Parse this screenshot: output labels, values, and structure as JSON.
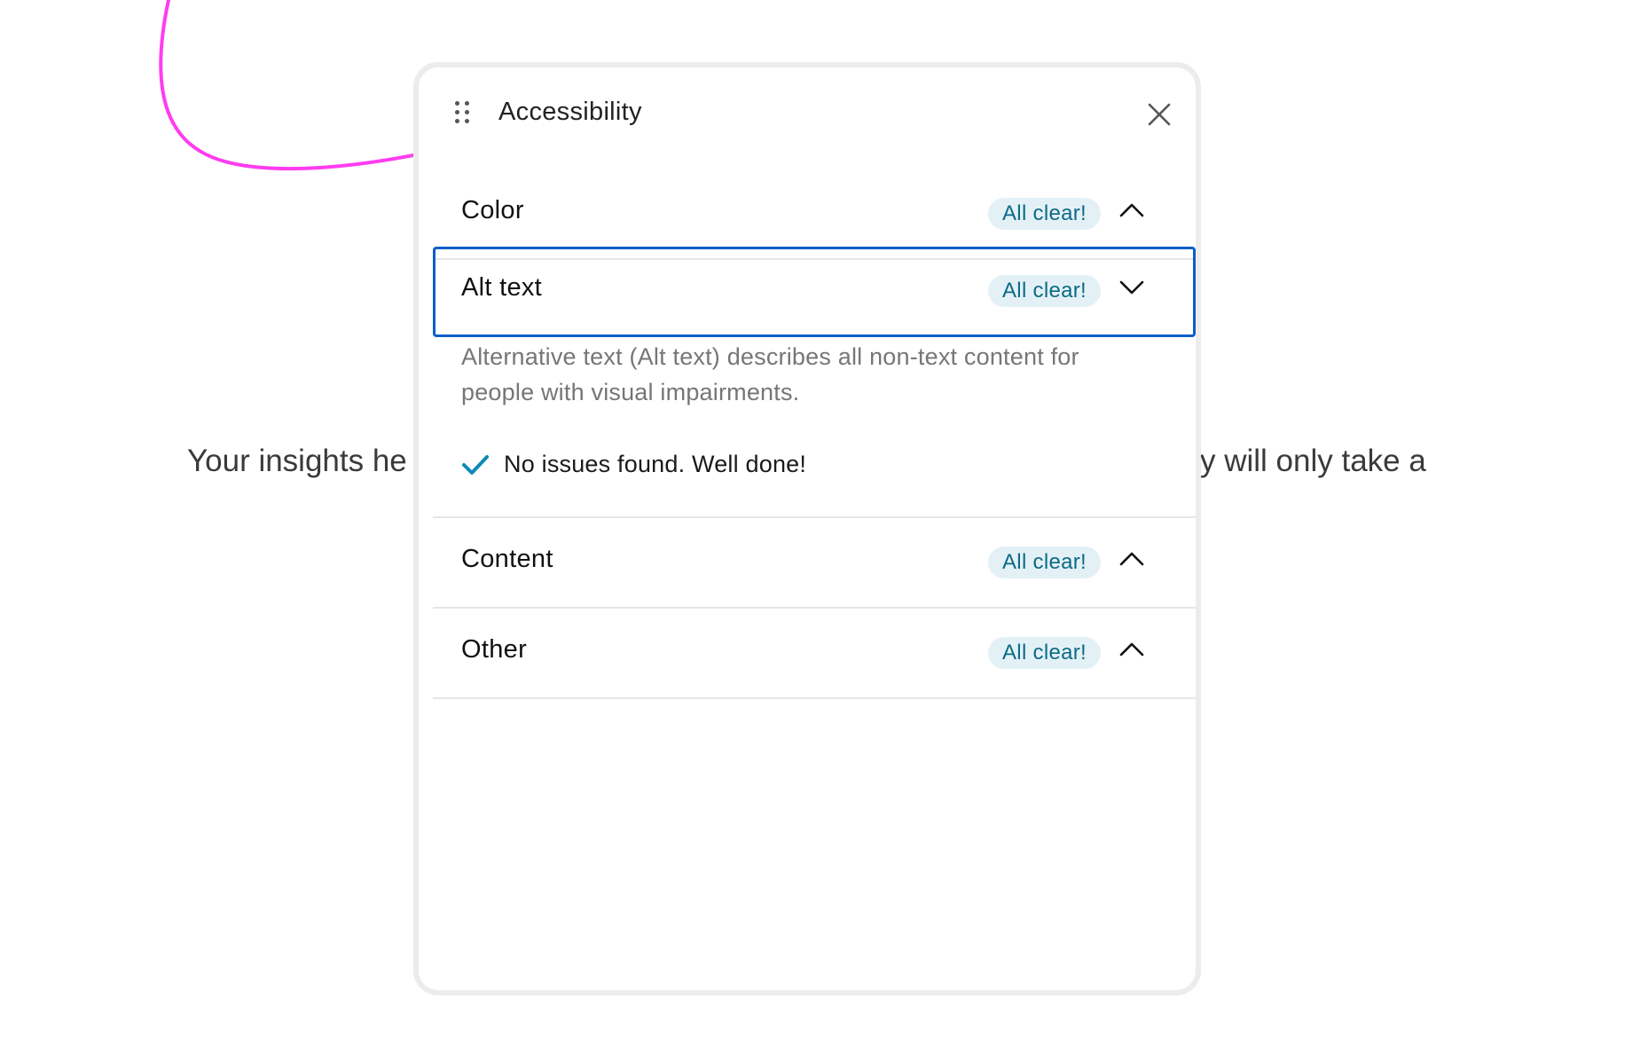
{
  "background": {
    "text_left": "Your insights he",
    "text_right": "y will only take a"
  },
  "annotation": {
    "arrow_color": "#ff3cf0"
  },
  "panel": {
    "title": "Accessibility",
    "grip_icon": "drag-handle-icon",
    "close_icon": "close-icon",
    "sections": [
      {
        "label": "Color",
        "status": "All clear!",
        "chevron": "chevron-up-icon",
        "expanded": false
      },
      {
        "label": "Alt text",
        "status": "All clear!",
        "chevron": "chevron-down-icon",
        "expanded": true,
        "focused": true,
        "description": "Alternative text (Alt text) describes all non-text content for people with visual impairments.",
        "result": "No issues found. Well done!",
        "result_icon": "checkmark-icon"
      },
      {
        "label": "Content",
        "status": "All clear!",
        "chevron": "chevron-up-icon",
        "expanded": false
      },
      {
        "label": "Other",
        "status": "All clear!",
        "chevron": "chevron-up-icon",
        "expanded": false
      }
    ]
  },
  "colors": {
    "focus_ring": "#0a5fc7",
    "badge_bg": "#e3f1f7",
    "badge_text": "#0d6a85",
    "check": "#0d8bb5"
  }
}
